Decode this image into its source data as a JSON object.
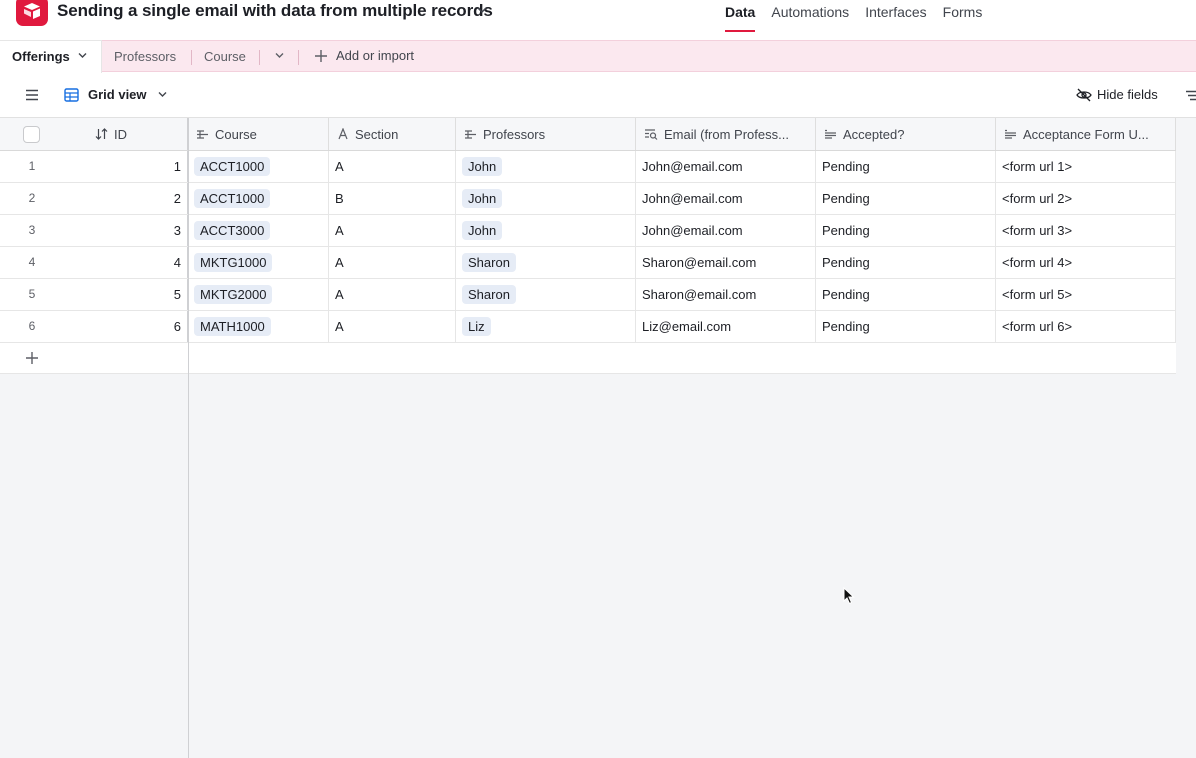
{
  "header": {
    "base_title": "Sending a single email with data from multiple records",
    "nav": [
      "Data",
      "Automations",
      "Interfaces",
      "Forms"
    ],
    "active_nav": "Data",
    "accent_color": "#e0193e"
  },
  "tables": {
    "active": "Offerings",
    "others": [
      "Professors",
      "Course"
    ],
    "add_label": "Add or import"
  },
  "viewbar": {
    "view_name": "Grid view",
    "hide_fields": "Hide fields"
  },
  "grid": {
    "columns": [
      {
        "label": "ID",
        "icon": "sort-icon"
      },
      {
        "label": "Course",
        "icon": "linked-record-icon"
      },
      {
        "label": "Section",
        "icon": "text-field-icon"
      },
      {
        "label": "Professors",
        "icon": "linked-record-icon"
      },
      {
        "label": "Email (from Profess...",
        "icon": "lookup-icon"
      },
      {
        "label": "Accepted?",
        "icon": "long-text-icon"
      },
      {
        "label": "Acceptance Form U...",
        "icon": "long-text-icon"
      }
    ],
    "rows": [
      {
        "num": "1",
        "id": "1",
        "course": "ACCT1000",
        "section": "A",
        "professor": "John",
        "email": "John@email.com",
        "accepted": "Pending",
        "form": "<form url 1>"
      },
      {
        "num": "2",
        "id": "2",
        "course": "ACCT1000",
        "section": "B",
        "professor": "John",
        "email": "John@email.com",
        "accepted": "Pending",
        "form": "<form url 2>"
      },
      {
        "num": "3",
        "id": "3",
        "course": "ACCT3000",
        "section": "A",
        "professor": "John",
        "email": "John@email.com",
        "accepted": "Pending",
        "form": "<form url 3>"
      },
      {
        "num": "4",
        "id": "4",
        "course": "MKTG1000",
        "section": "A",
        "professor": "Sharon",
        "email": "Sharon@email.com",
        "accepted": "Pending",
        "form": "<form url 4>"
      },
      {
        "num": "5",
        "id": "5",
        "course": "MKTG2000",
        "section": "A",
        "professor": "Sharon",
        "email": "Sharon@email.com",
        "accepted": "Pending",
        "form": "<form url 5>"
      },
      {
        "num": "6",
        "id": "6",
        "course": "MATH1000",
        "section": "A",
        "professor": "Liz",
        "email": "Liz@email.com",
        "accepted": "Pending",
        "form": "<form url 6>"
      }
    ]
  }
}
